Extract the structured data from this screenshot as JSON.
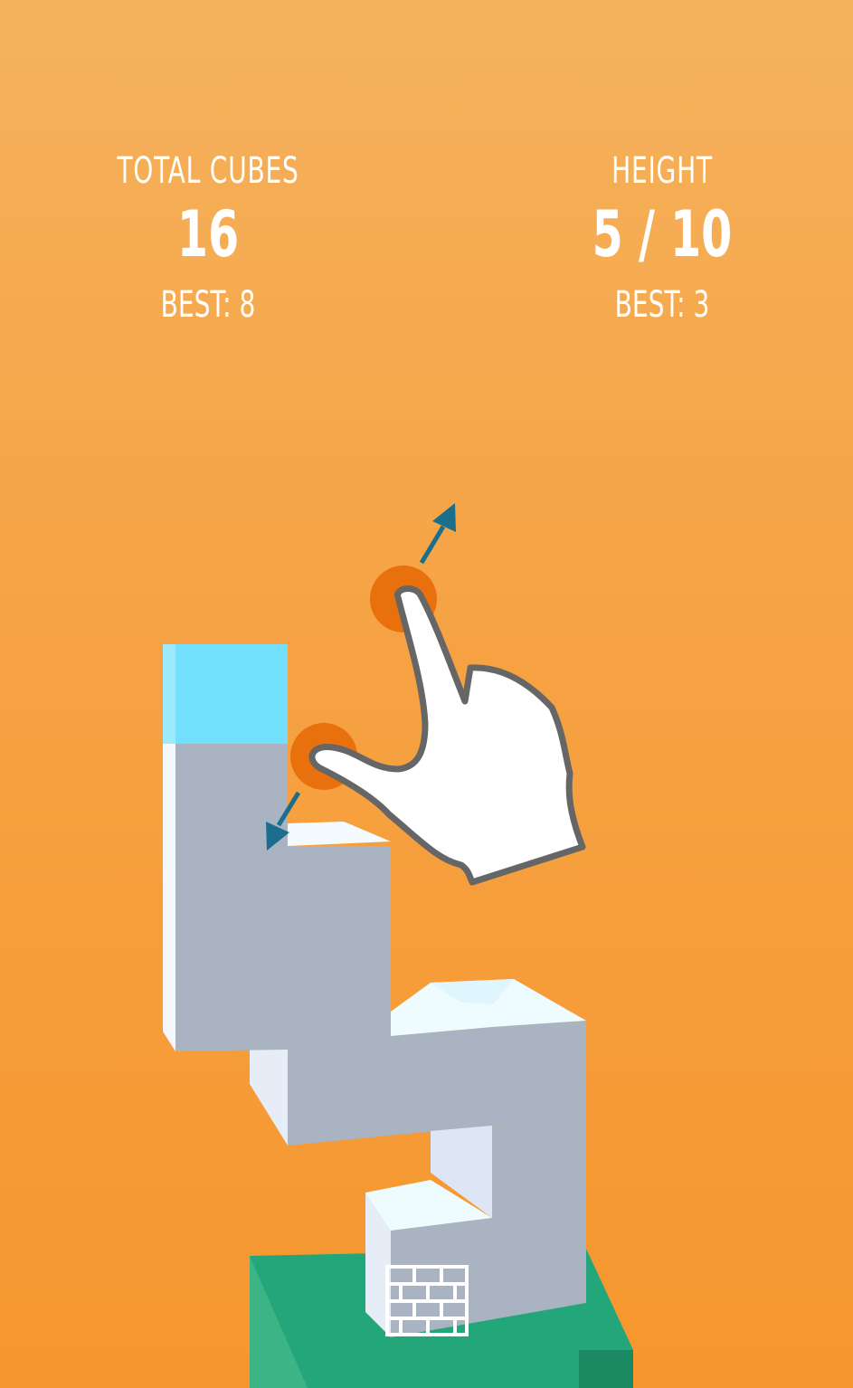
{
  "total_cubes": {
    "label": "TOTAL CUBES",
    "value": "16",
    "best": "BEST: 8"
  },
  "height": {
    "label": "HEIGHT",
    "value": "5 / 10",
    "best": "BEST: 3"
  },
  "colors": {
    "background_top": "#f5b25d",
    "background_bottom": "#f6962e",
    "block_front": "#a9b3c2",
    "block_top": "#eefcff",
    "block_side": "#dfe6f2",
    "highlight_cube": "#72dffc",
    "base": "#22a67a",
    "touch_point": "#e8700d",
    "arrow": "#1b6f8c"
  },
  "icons": {
    "gesture": "two-finger-pinch-hand-icon",
    "build": "brick-wall-icon"
  }
}
